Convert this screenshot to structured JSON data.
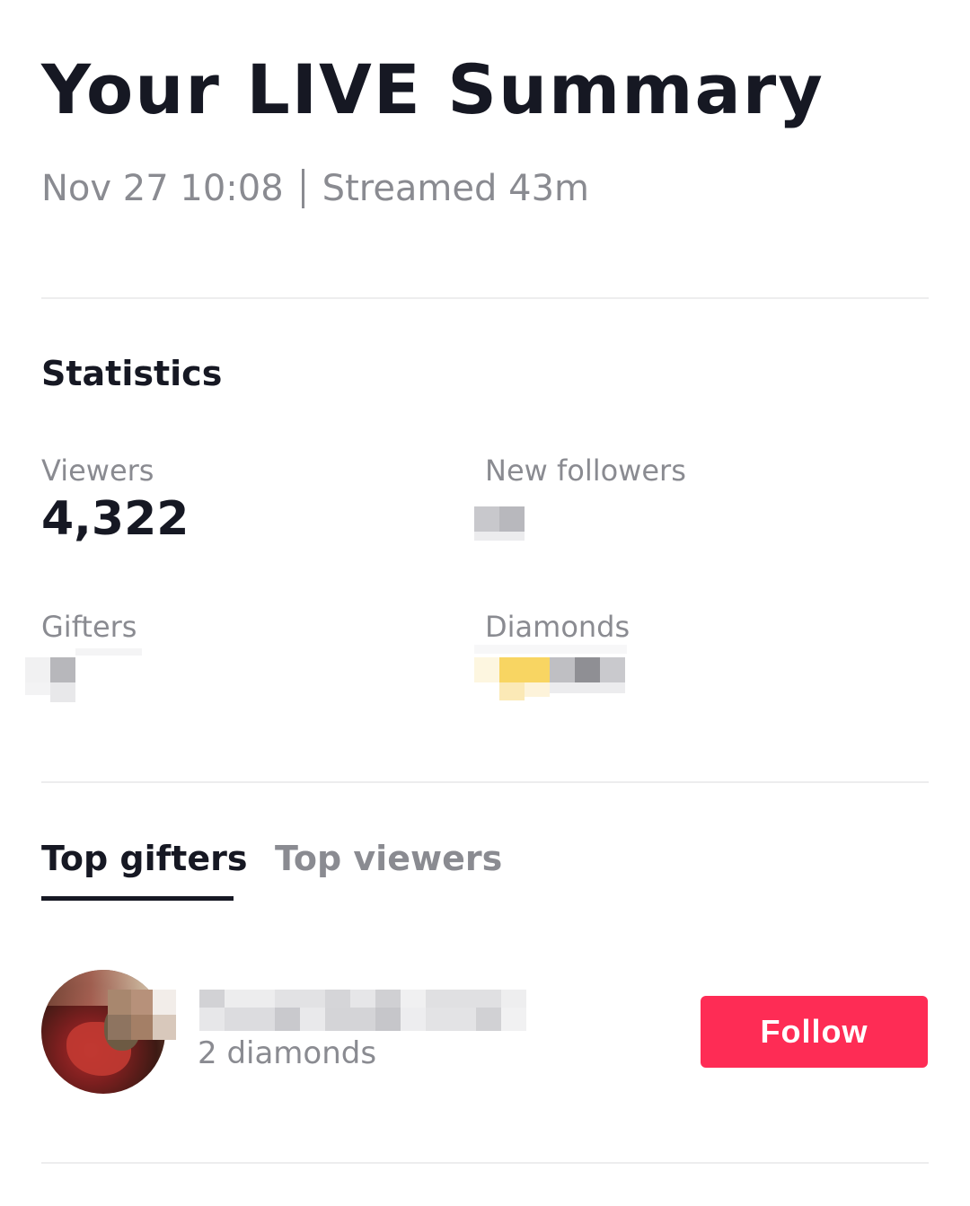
{
  "header": {
    "title": "Your LIVE Summary",
    "date": "Nov 27 10:08",
    "duration": "Streamed 43m"
  },
  "statistics": {
    "section_title": "Statistics",
    "viewers_label": "Viewers",
    "viewers_value": "4,322",
    "new_followers_label": "New followers",
    "gifters_label": "Gifters",
    "diamonds_label": "Diamonds"
  },
  "tabs": [
    {
      "label": "Top gifters",
      "active": true
    },
    {
      "label": "Top viewers",
      "active": false
    }
  ],
  "top_gifters": [
    {
      "subtitle": "2 diamonds",
      "follow_label": "Follow"
    }
  ],
  "colors": {
    "accent": "#fe2c55",
    "text_primary": "#161823",
    "text_secondary": "#8a8b91",
    "divider": "#ededee"
  }
}
